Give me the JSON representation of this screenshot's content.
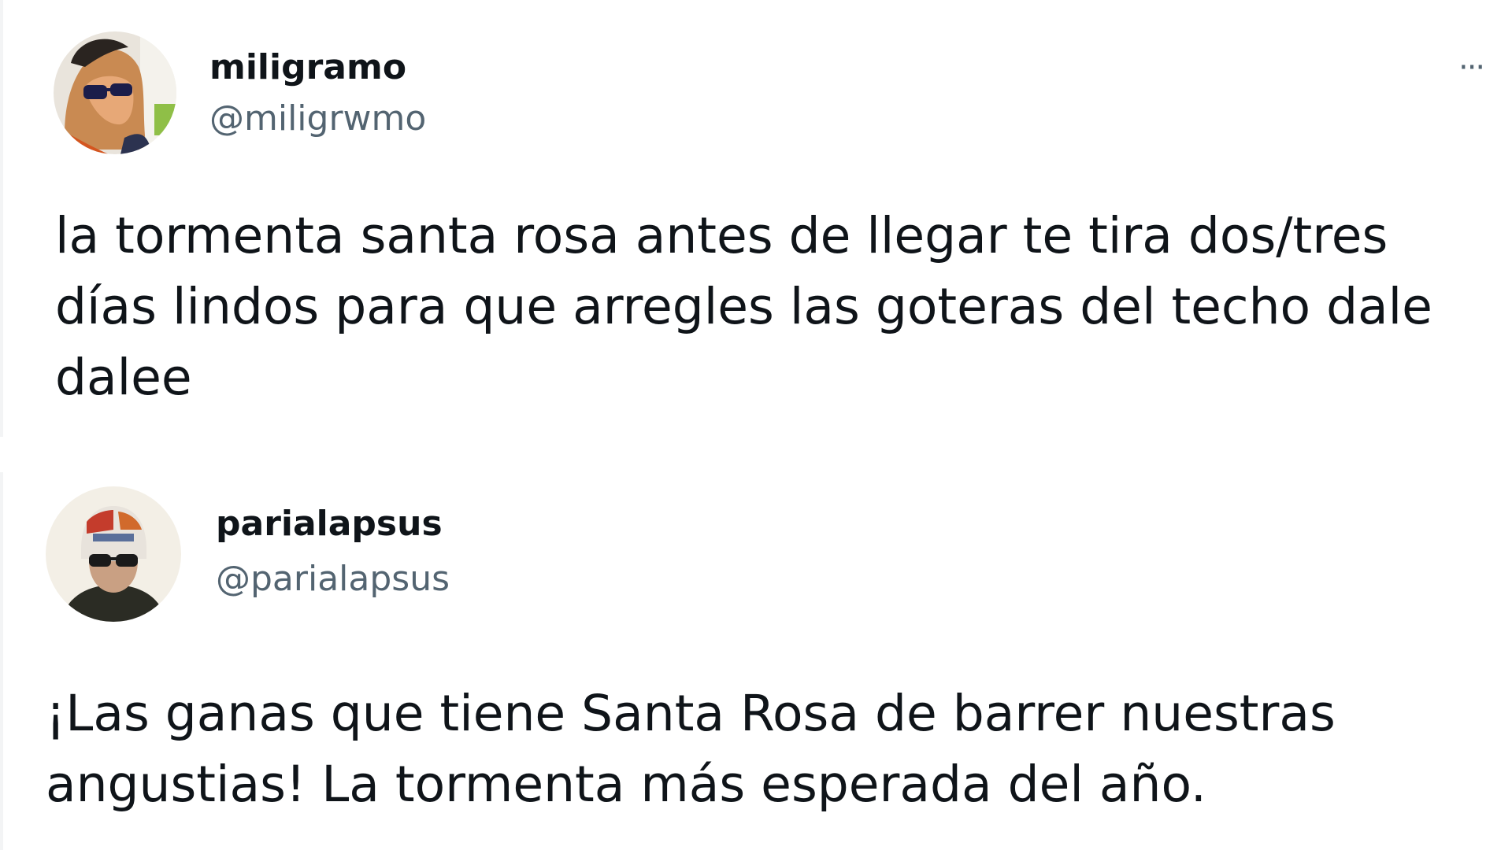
{
  "tweets": [
    {
      "display_name": "miligramo",
      "handle": "@miligrwmo",
      "text": "la tormenta santa rosa antes de llegar te tira dos/tres días lindos para que arregles las goteras del techo dale dalee",
      "more_label": "···",
      "avatar_icon": "user-avatar-sunglasses"
    },
    {
      "display_name": "parialapsus",
      "handle": "@parialapsus",
      "text": "¡Las ganas que tiene Santa Rosa de barrer nuestras angustias! La tormenta más esperada del año.",
      "avatar_icon": "user-avatar-helmet"
    }
  ],
  "colors": {
    "text_primary": "#0f1419",
    "text_secondary": "#536471",
    "background": "#ffffff",
    "divider": "#f3f4f5"
  }
}
